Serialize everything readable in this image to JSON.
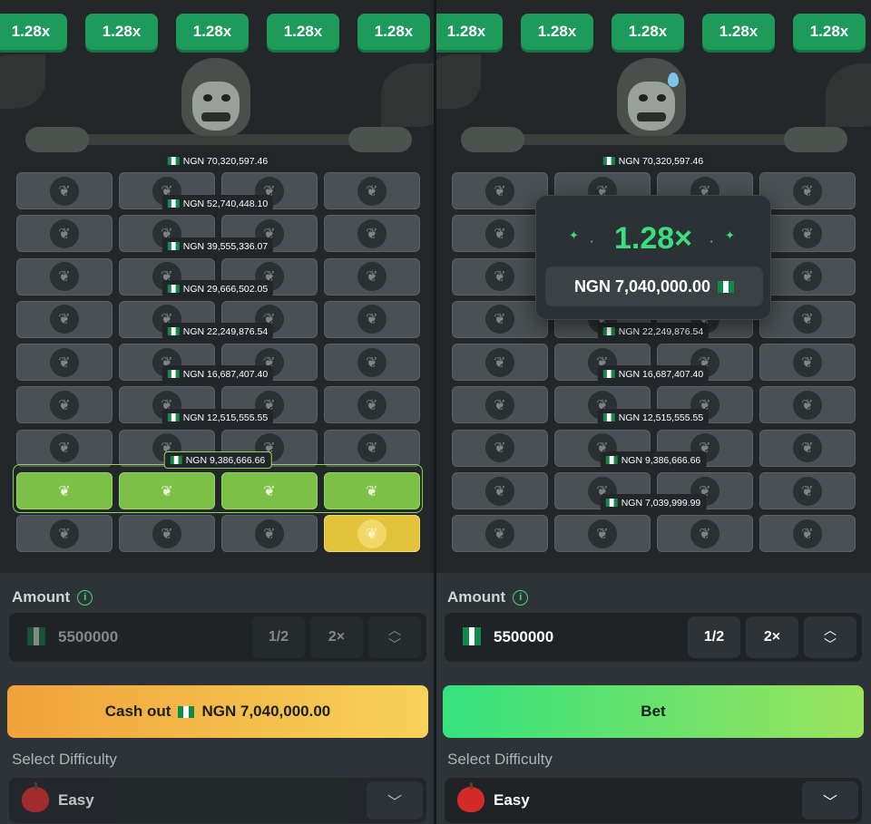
{
  "colors": {
    "accent_green": "#3ddc7f",
    "multiplier_bg": "#1e9b5a",
    "tile_green": "#7dc047",
    "tile_gold": "#e3c23c",
    "cashout_gradient": [
      "#f0a23a",
      "#f7d25a"
    ],
    "bet_gradient": [
      "#34e27e",
      "#9be35c"
    ]
  },
  "left": {
    "multipliers": [
      "1.28x",
      "1.28x",
      "1.28x",
      "1.28x",
      "1.28x"
    ],
    "payouts": [
      "NGN 70,320,597.46",
      "NGN 52,740,448.10",
      "NGN 39,555,336.07",
      "NGN 29,666,502.05",
      "NGN 22,249,876.54",
      "NGN 16,687,407.40",
      "NGN 12,515,555.55",
      "NGN 9,386,666.66"
    ],
    "grid_rows": [
      [
        "default",
        "default",
        "default",
        "default"
      ],
      [
        "default",
        "default",
        "default",
        "default"
      ],
      [
        "default",
        "default",
        "default",
        "default"
      ],
      [
        "default",
        "default",
        "default",
        "default"
      ],
      [
        "default",
        "default",
        "default",
        "default"
      ],
      [
        "default",
        "default",
        "default",
        "default"
      ],
      [
        "default",
        "default",
        "default",
        "default"
      ],
      [
        "green",
        "green",
        "green",
        "green"
      ],
      [
        "default",
        "default",
        "default",
        "gold"
      ]
    ],
    "amount_label": "Amount",
    "amount_value": "5500000",
    "half_label": "1/2",
    "double_label": "2×",
    "cashout_label": "Cash out",
    "cashout_amount": "NGN 7,040,000.00",
    "difficulty_label": "Select Difficulty",
    "difficulty_value": "Easy"
  },
  "right": {
    "multipliers": [
      "1.28x",
      "1.28x",
      "1.28x",
      "1.28x",
      "1.28x"
    ],
    "payouts": [
      "NGN 70,320,597.46",
      "NGN 22,249,876.54",
      "NGN 16,687,407.40",
      "NGN 12,515,555.55",
      "NGN 9,386,666.66",
      "NGN 7,039,999.99"
    ],
    "win_multiplier": "1.28×",
    "win_amount": "NGN 7,040,000.00",
    "amount_label": "Amount",
    "amount_value": "5500000",
    "half_label": "1/2",
    "double_label": "2×",
    "bet_label": "Bet",
    "difficulty_label": "Select Difficulty",
    "difficulty_value": "Easy"
  },
  "icons": {
    "tile": "apple-icon",
    "info": "info-icon",
    "stepper": "up-down-icon",
    "chevron": "chevron-down-icon",
    "sparkle": "sparkle-icon",
    "flag": "nigeria-flag-icon"
  }
}
